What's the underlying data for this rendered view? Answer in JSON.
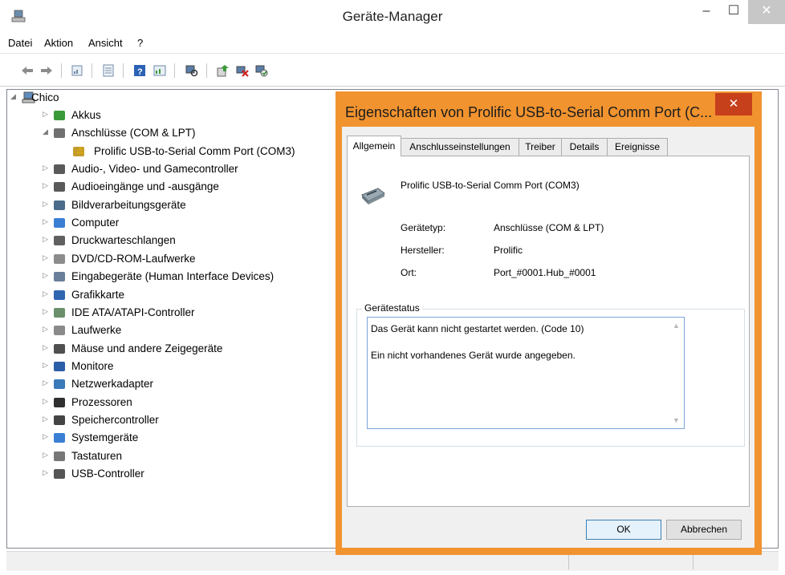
{
  "window": {
    "title": "Geräte-Manager"
  },
  "menu": {
    "items": [
      "Datei",
      "Aktion",
      "Ansicht",
      "?"
    ]
  },
  "tree": {
    "root": "Chico",
    "categories": [
      "Akkus",
      "Anschlüsse (COM & LPT)",
      "Prolific USB-to-Serial Comm Port (COM3)",
      "Audio-, Video- und Gamecontroller",
      "Audioeingänge und -ausgänge",
      "Bildverarbeitungsgeräte",
      "Computer",
      "Druckwarteschlangen",
      "DVD/CD-ROM-Laufwerke",
      "Eingabegeräte (Human Interface Devices)",
      "Grafikkarte",
      "IDE ATA/ATAPI-Controller",
      "Laufwerke",
      "Mäuse und andere Zeigegeräte",
      "Monitore",
      "Netzwerkadapter",
      "Prozessoren",
      "Speichercontroller",
      "Systemgeräte",
      "Tastaturen",
      "USB-Controller"
    ]
  },
  "dialog": {
    "title": "Eigenschaften von Prolific USB-to-Serial Comm Port (C...",
    "close_label": "✕",
    "tabs": [
      "Allgemein",
      "Anschlusseinstellungen",
      "Treiber",
      "Details",
      "Ereignisse"
    ],
    "device_name": "Prolific USB-to-Serial Comm Port (COM3)",
    "props": {
      "type_label": "Gerätetyp:",
      "type_value": "Anschlüsse (COM & LPT)",
      "maker_label": "Hersteller:",
      "maker_value": "Prolific",
      "location_label": "Ort:",
      "location_value": "Port_#0001.Hub_#0001"
    },
    "status_legend": "Gerätestatus",
    "status_line1": "Das Gerät kann nicht gestartet werden. (Code 10)",
    "status_line2": "Ein nicht vorhandenes Gerät wurde angegeben.",
    "ok_label": "OK",
    "cancel_label": "Abbrechen"
  },
  "colors": {
    "dialog_border": "#f1932f",
    "close_red": "#c6401c",
    "default_button": "#3c7fb1"
  }
}
